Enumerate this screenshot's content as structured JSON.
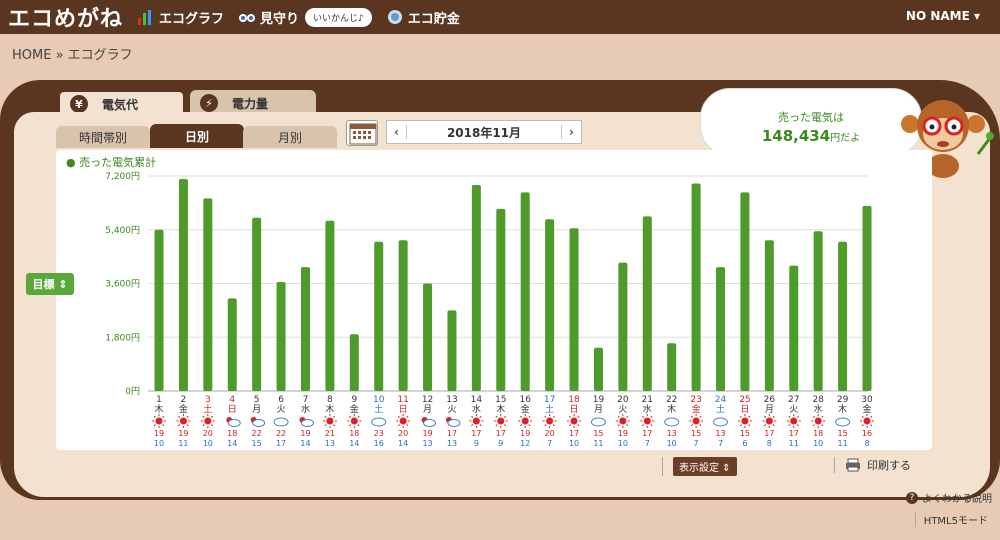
{
  "header": {
    "logo": "エコめがね",
    "nav": [
      {
        "label": "エコグラフ",
        "icon": "bar-chart-icon"
      },
      {
        "label": "見守り",
        "icon": "watch-icon"
      },
      {
        "label": "エコ貯金",
        "icon": "coin-icon"
      }
    ],
    "badge": "いいかんじ♪",
    "user": "NO NAME ▾"
  },
  "breadcrumb": "HOME » エコグラフ",
  "tabs": {
    "electric_cost": "電気代",
    "electric_power": "電力量"
  },
  "subtabs": {
    "hourly": "時間帯別",
    "daily": "日別",
    "monthly": "月別"
  },
  "date": {
    "prev": "‹",
    "label": "2018年11月",
    "next": "›"
  },
  "speech": {
    "line1": "売った電気は",
    "amount": "148,434",
    "unit": "円だよ"
  },
  "legend": "● 売った電気累計",
  "goal_button": "目標 ⇕",
  "display_settings": "表示設定 ⇕",
  "print": "印刷する",
  "help": "よくわかる説明",
  "html5": "HTML5モード",
  "colors": {
    "bar": "#4e9a2a",
    "accent": "#5a3520",
    "red": "#d22020",
    "blue": "#2a6fd0"
  },
  "chart_data": {
    "type": "bar",
    "title": "",
    "legend": "売った電気累計",
    "ylim": [
      0,
      7200
    ],
    "yticks": [
      "0円",
      "1,800円",
      "3,600円",
      "5,400円",
      "7,200円"
    ],
    "days": [
      "1",
      "2",
      "3",
      "4",
      "5",
      "6",
      "7",
      "8",
      "9",
      "10",
      "11",
      "12",
      "13",
      "14",
      "15",
      "16",
      "17",
      "18",
      "19",
      "20",
      "21",
      "22",
      "23",
      "24",
      "25",
      "26",
      "27",
      "28",
      "29",
      "30"
    ],
    "weekdays": [
      "木",
      "金",
      "土",
      "日",
      "月",
      "火",
      "水",
      "木",
      "金",
      "土",
      "日",
      "月",
      "火",
      "水",
      "木",
      "金",
      "土",
      "日",
      "月",
      "火",
      "水",
      "木",
      "金",
      "土",
      "日",
      "月",
      "火",
      "水",
      "木",
      "金"
    ],
    "day_colors": [
      "n",
      "n",
      "r",
      "r",
      "n",
      "n",
      "n",
      "n",
      "n",
      "b",
      "r",
      "n",
      "n",
      "n",
      "n",
      "n",
      "b",
      "r",
      "n",
      "n",
      "n",
      "n",
      "r",
      "b",
      "r",
      "n",
      "n",
      "n",
      "n",
      "n"
    ],
    "values": [
      5400,
      7100,
      6450,
      3100,
      5800,
      3650,
      4150,
      5700,
      1900,
      5000,
      5050,
      3600,
      2700,
      6900,
      6100,
      6650,
      5750,
      5450,
      1450,
      4300,
      5850,
      1600,
      6950,
      4150,
      6650,
      5050,
      4200,
      5350,
      5000,
      6200
    ],
    "weather": [
      "sun",
      "sun",
      "sun",
      "sun-cloud",
      "sun-cloud",
      "cloud",
      "sun-cloud",
      "sun",
      "sun",
      "cloud",
      "sun",
      "sun-cloud",
      "sun-cloud",
      "sun",
      "sun",
      "sun",
      "sun",
      "sun",
      "cloud",
      "sun",
      "sun",
      "cloud",
      "sun",
      "cloud",
      "sun",
      "sun",
      "sun",
      "sun",
      "cloud",
      "sun"
    ],
    "temp_high": [
      "19",
      "19",
      "20",
      "18",
      "22",
      "22",
      "19",
      "21",
      "18",
      "23",
      "20",
      "19",
      "17",
      "17",
      "17",
      "19",
      "20",
      "17",
      "15",
      "19",
      "17",
      "13",
      "15",
      "13",
      "15",
      "17",
      "17",
      "18",
      "15",
      "16"
    ],
    "temp_low": [
      "10",
      "11",
      "10",
      "14",
      "15",
      "17",
      "14",
      "13",
      "14",
      "16",
      "14",
      "13",
      "13",
      "9",
      "9",
      "12",
      "7",
      "10",
      "11",
      "10",
      "7",
      "10",
      "7",
      "7",
      "6",
      "8",
      "11",
      "10",
      "11",
      "8"
    ]
  }
}
